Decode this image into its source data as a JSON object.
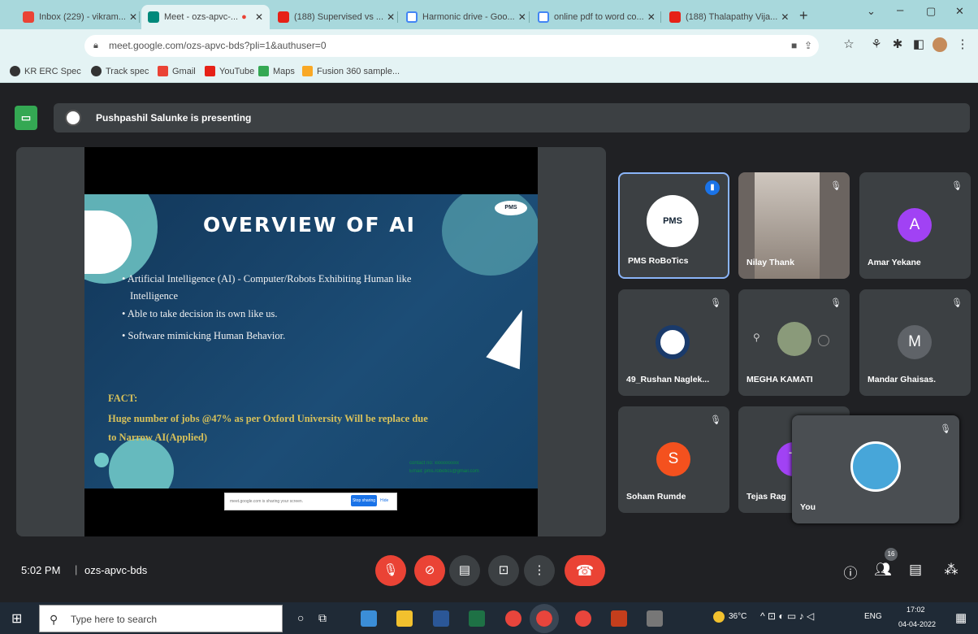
{
  "browser": {
    "tabs": [
      {
        "title": "Inbox (229) - vikram..."
      },
      {
        "title": "Meet - ozs-apvc-..."
      },
      {
        "title": "(188) Supervised vs ..."
      },
      {
        "title": "Harmonic drive - Goo..."
      },
      {
        "title": "online pdf to word co..."
      },
      {
        "title": "(188) Thalapathy Vija..."
      }
    ],
    "new_tab": "+",
    "url": "meet.google.com/ozs-apvc-bds?pli=1&authuser=0",
    "bookmarks": [
      "KR ERC Spec",
      "Track spec",
      "Gmail",
      "YouTube",
      "Maps",
      "Fusion 360 sample..."
    ]
  },
  "meet": {
    "presenting_text": "Pushpashil Salunke is presenting",
    "presenter_icon_text": "▭",
    "slide": {
      "title": "OVERVIEW OF AI",
      "bullets": [
        "Artificial Intelligence (AI) - Computer/Robots Exhibiting Human like",
        "Intelligence",
        "Able to take decision its own like us.",
        "Software mimicking Human Behavior."
      ],
      "fact_label": "FACT:",
      "fact_lines": [
        "Huge number of jobs @47% as per Oxford University Will be replace due",
        "to Narrow AI(Applied)"
      ],
      "logo_text": "PMS",
      "contact_lines": [
        "contact no: xxxxxxxxxx",
        "Email: pms.robotics@gmail.com"
      ]
    },
    "share_notice": {
      "text": "meet.google.com is sharing your screen.",
      "stop_label": "Stop sharing",
      "hide_label": "Hide"
    },
    "participants": [
      {
        "name": "PMS RoBoTics",
        "avatar": "PMS",
        "speaking": true
      },
      {
        "name": "Nilay Thank",
        "avatar": ""
      },
      {
        "name": "Amar Yekane",
        "avatar": "A",
        "color": "#a142f4"
      },
      {
        "name": "49_Rushan Naglek...",
        "avatar": ""
      },
      {
        "name": "MEGHA KAMATI",
        "avatar": ""
      },
      {
        "name": "Mandar Ghaisas.",
        "avatar": "M",
        "color": "#5f6368"
      },
      {
        "name": "Soham Rumde",
        "avatar": "S",
        "color": "#f4511e"
      },
      {
        "name": "Tejas Rag",
        "avatar": "T",
        "color": "#a142f4"
      },
      {
        "name": "You",
        "avatar": ""
      }
    ],
    "time": "5:02 PM",
    "separator": "|",
    "meeting_code": "ozs-apvc-bds",
    "participant_count": "16"
  },
  "taskbar": {
    "search_placeholder": "Type here to search",
    "weather": "36°C",
    "language": "ENG",
    "clock_time": "17:02",
    "clock_date": "04-04-2022"
  },
  "colors": {
    "accent": "#1a73e8",
    "danger": "#ea4335",
    "meet_bg": "#202124",
    "tile_bg": "#3c4043"
  }
}
